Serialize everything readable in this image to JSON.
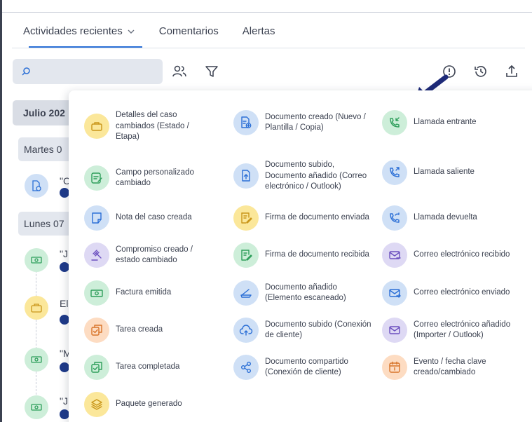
{
  "tabs": [
    {
      "label": "Actividades recientes"
    },
    {
      "label": "Comentarios"
    },
    {
      "label": "Alertas"
    }
  ],
  "search": {
    "value": "",
    "placeholder": ""
  },
  "timeline": {
    "month": "Julio 202",
    "days": [
      "Martes 0",
      "Lunes 07"
    ],
    "snippets": [
      "\"C",
      "\"J",
      "El",
      "\"M",
      "\"J"
    ]
  },
  "menu": {
    "items": [
      {
        "label": "Detalles del caso cambiados (Estado / Etapa)",
        "icon": "briefcase-icon",
        "color": "yellow"
      },
      {
        "label": "Campo personalizado cambiado",
        "icon": "edit-field-icon",
        "color": "green"
      },
      {
        "label": "Nota del caso creada",
        "icon": "note-icon",
        "color": "blue"
      },
      {
        "label": "Compromiso creado / estado cambiado",
        "icon": "gavel-icon",
        "color": "purple"
      },
      {
        "label": "Factura emitida",
        "icon": "banknote-icon",
        "color": "green"
      },
      {
        "label": "Tarea creada",
        "icon": "task-icon",
        "color": "orange"
      },
      {
        "label": "Tarea completada",
        "icon": "task-done-icon",
        "color": "green"
      },
      {
        "label": "Paquete generado",
        "icon": "layers-icon",
        "color": "yellow"
      },
      {
        "label": "Documento creado (Nuevo / Plantilla / Copia)",
        "icon": "document-add-icon",
        "color": "blue"
      },
      {
        "label": "Documento subido, Documento añadido (Correo electrónico / Outlook)",
        "icon": "file-upload-icon",
        "color": "blue"
      },
      {
        "label": "Firma de documento enviada",
        "icon": "signature-icon",
        "color": "yellow"
      },
      {
        "label": "Firma de documento recibida",
        "icon": "signature-icon",
        "color": "green"
      },
      {
        "label": "Documento añadido (Elemento escaneado)",
        "icon": "scanner-icon",
        "color": "blue"
      },
      {
        "label": "Documento subido (Conexión de cliente)",
        "icon": "cloud-upload-icon",
        "color": "blue"
      },
      {
        "label": "Documento compartido (Conexión de cliente)",
        "icon": "share-icon",
        "color": "blue"
      },
      {
        "label": "Llamada entrante",
        "icon": "phone-incoming-icon",
        "color": "green"
      },
      {
        "label": "Llamada saliente",
        "icon": "phone-outgoing-icon",
        "color": "blue"
      },
      {
        "label": "Llamada devuelta",
        "icon": "phone-return-icon",
        "color": "blue"
      },
      {
        "label": "Correo electrónico recibido",
        "icon": "mail-in-icon",
        "color": "purple"
      },
      {
        "label": "Correo electrónico enviado",
        "icon": "mail-out-icon",
        "color": "blue"
      },
      {
        "label": "Correo electrónico añadido (Importer / Outlook)",
        "icon": "mail-add-icon",
        "color": "purple"
      },
      {
        "label": "Evento / fecha clave creado/cambiado",
        "icon": "calendar-icon",
        "color": "orange"
      }
    ]
  }
}
